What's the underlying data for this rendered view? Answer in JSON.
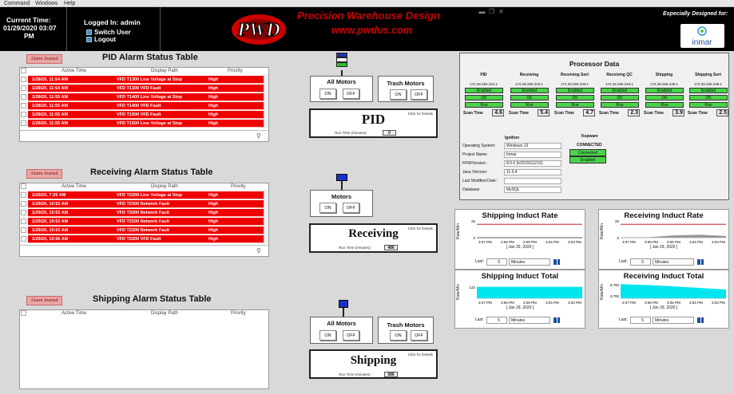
{
  "menubar": [
    "Command",
    "Windows",
    "Help"
  ],
  "header": {
    "current_time_label": "Current Time:",
    "current_time_value": "01/29/2020 03:07",
    "current_time_ampm": "PM",
    "logged_in": "Logged In: admin",
    "switch_user": "Switch User",
    "logout": "Logout",
    "logo_text": "PWD",
    "company_name": "Precision Warehouse Design",
    "company_url": "www.pwdus.com",
    "designed_for": "Especially Designed for:",
    "client_name": "inmar"
  },
  "pid_table": {
    "title": "PID Alarm Status Table",
    "journal_button": "Alarm Journal",
    "columns": [
      "Active Time",
      "Display Path",
      "Priority"
    ],
    "rows": [
      [
        "1/28/20, 11:54 AM",
        "VFD T1300 Line Voltage at Stop",
        "High"
      ],
      [
        "1/28/20, 11:54 AM",
        "VFD T1300 VFD Fault",
        "High"
      ],
      [
        "1/28/20, 11:55 AM",
        "VFD T1400 Line Voltage at Stop",
        "High"
      ],
      [
        "1/28/20, 11:55 AM",
        "VFD T1400 VFD Fault",
        "High"
      ],
      [
        "1/28/20, 11:55 AM",
        "VFD T1500 VFD Fault",
        "High"
      ],
      [
        "1/28/20, 11:55 AM",
        "VFD T1500 Line Voltage at Stop",
        "High"
      ]
    ]
  },
  "receiving_table": {
    "title": "Receiving Alarm Status Table",
    "journal_button": "Alarm Journal",
    "columns": [
      "Active Time",
      "Display Path",
      "Priority"
    ],
    "rows": [
      [
        "1/29/20, 7:26 AM",
        "VFD T2200 Line Voltage at Stop",
        "High"
      ],
      [
        "1/29/20, 10:53 AM",
        "VFD T2300 Network Fault",
        "High"
      ],
      [
        "1/29/20, 10:53 AM",
        "VFD T2000 Network Fault",
        "High"
      ],
      [
        "1/29/20, 10:53 AM",
        "VFD T2100 Network Fault",
        "High"
      ],
      [
        "1/29/20, 10:53 AM",
        "VFD T2200 Network Fault",
        "High"
      ],
      [
        "1/29/20, 10:56 AM",
        "VFD T2200 VFD Fault",
        "High"
      ]
    ]
  },
  "shipping_table": {
    "title": "Shipping Alarm Status Table",
    "journal_button": "Alarm Journal",
    "columns": [
      "Active Time",
      "Display Path",
      "Priority"
    ],
    "rows": []
  },
  "controls": {
    "pid": {
      "all_motors": "All Motors",
      "trash_motors": "Trash Motors",
      "on": "ON",
      "off": "OFF",
      "name": "PID",
      "click": "Click for Details",
      "run_time_label": "Run Time (minutes) :",
      "run_time": "0"
    },
    "receiving": {
      "motors": "Motors",
      "on": "ON",
      "off": "OFF",
      "name": "Receiving",
      "click": "Click for Details",
      "run_time_label": "Run Time (minutes) :",
      "run_time": "486"
    },
    "shipping": {
      "all_motors": "All Motors",
      "trash_motors": "Trash Motors",
      "on": "ON",
      "off": "OFF",
      "name": "Shipping",
      "click": "Click for Details",
      "run_time_label": "Run Time (minutes) :",
      "run_time": "586"
    }
  },
  "processor": {
    "title": "Processor Data",
    "columns": [
      {
        "name": "PID",
        "ip": "172.28.255.231:1",
        "s1": "Enabled",
        "s2": "OK",
        "s3": "Run",
        "scan": "4.6"
      },
      {
        "name": "Receiving",
        "ip": "172.28.255.232:1",
        "s1": "Enabled",
        "s2": "OK",
        "s3": "Run",
        "scan": "5.4"
      },
      {
        "name": "Receiving Sort",
        "ip": "172.28.255.233:1",
        "s1": "Enabled",
        "s2": "OK",
        "s3": "Run",
        "scan": "4.7"
      },
      {
        "name": "Receiving QC",
        "ip": "172.28.255.234:1",
        "s1": "Enabled",
        "s2": "OK",
        "s3": "Run",
        "scan": "2.3"
      },
      {
        "name": "Shipping",
        "ip": "172.28.255.235:1",
        "s1": "Enabled",
        "s2": "OK",
        "s3": "Run",
        "scan": "3.9"
      },
      {
        "name": "Shipping Sort",
        "ip": "172.28.255.236:1",
        "s1": "Enabled",
        "s2": "OK",
        "s3": "Run",
        "scan": "2.5"
      }
    ],
    "scan_label": "Scan Time",
    "ignition_title": "Ignition",
    "ignition": [
      {
        "label": "Operating System:",
        "value": "Windows 10"
      },
      {
        "label": "Project Name:",
        "value": "Inmar"
      },
      {
        "label": "FPM/Version:",
        "value": "8.0.6 (b2019111216)"
      },
      {
        "label": "Java /Version:",
        "value": "11.0.4"
      },
      {
        "label": "Last Modified Date:",
        "value": ""
      },
      {
        "label": "Database",
        "value": "MySQL"
      }
    ],
    "kepware_title": "Kepware",
    "kepware_status": "CONNECTED",
    "kepware_connected": "Connected",
    "kepware_enabled": "Enabled"
  },
  "charts_ui": {
    "last_label": "Last:",
    "last_value": "5",
    "unit": "Minutes",
    "ylabel": "Rate/Min",
    "date": "[ Jan 29, 2020 ]"
  },
  "chart_data": [
    {
      "type": "line",
      "title": "Shipping Induct Rate",
      "ylabel": "Rate/Min",
      "xlabel": "[ Jan 29, 2020 ]",
      "x": [
        "3:07 PM",
        "3:06 PM",
        "3:05 PM",
        "3:04 PM",
        "3:03 PM"
      ],
      "y_ticks": [
        "25",
        "0"
      ],
      "ylim": [
        0,
        25
      ],
      "series": [
        {
          "values": [
            0,
            0,
            0,
            0,
            0
          ],
          "color": "#c00000"
        }
      ],
      "reference_line": 20
    },
    {
      "type": "area",
      "title": "Receiving Induct Rate",
      "ylabel": "Rate/Min",
      "xlabel": "[ Jan 29, 2020 ]",
      "x": [
        "3:07 PM",
        "3:06 PM",
        "3:05 PM",
        "3:04 PM",
        "3:03 PM"
      ],
      "y_ticks": [
        "25",
        "0"
      ],
      "ylim": [
        0,
        25
      ],
      "series": [
        {
          "values": [
            0,
            0,
            3,
            4,
            2
          ],
          "color": "#999999"
        }
      ],
      "reference_line": 20
    },
    {
      "type": "area",
      "title": "Shipping Induct Total",
      "ylabel": "Rate/Min",
      "xlabel": "[ Jan 29, 2020 ]",
      "x": [
        "3:07 PM",
        "3:06 PM",
        "3:05 PM",
        "3:04 PM",
        "3:03 PM"
      ],
      "y_ticks": [
        "122"
      ],
      "ylim": [
        118,
        124
      ],
      "series": [
        {
          "values": [
            122,
            122,
            122,
            122,
            122
          ],
          "color": "#00e5ee"
        }
      ]
    },
    {
      "type": "area",
      "title": "Receiving Induct Total",
      "ylabel": "Rate/Min",
      "xlabel": "[ Jan 29, 2020 ]",
      "x": [
        "3:07 PM",
        "3:06 PM",
        "3:05 PM",
        "3:04 PM",
        "3:03 PM"
      ],
      "y_ticks": [
        "3,750",
        "3,700"
      ],
      "ylim": [
        3690,
        3765
      ],
      "series": [
        {
          "values": [
            3752,
            3748,
            3742,
            3735,
            3728
          ],
          "color": "#00e5ee"
        }
      ]
    }
  ]
}
